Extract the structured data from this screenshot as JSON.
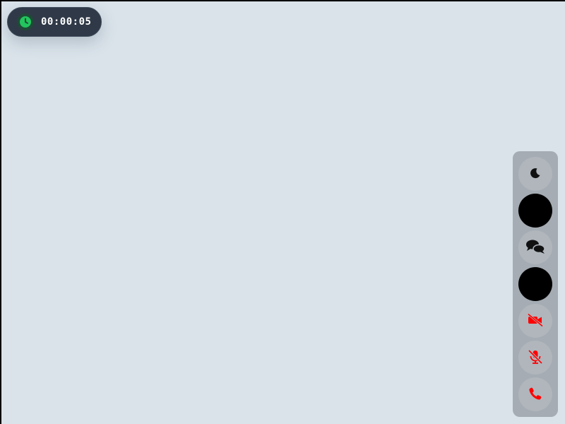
{
  "timer": {
    "elapsed": "00:00:05",
    "icon": "clock-icon",
    "accent": "#22c55e"
  },
  "controls": [
    {
      "name": "dark-mode-toggle",
      "icon": "moon-icon",
      "color": "#111111"
    },
    {
      "name": "participant-slot-1",
      "icon": "",
      "color": "#000000"
    },
    {
      "name": "chat-button",
      "icon": "chat-bubbles-icon",
      "color": "#111111"
    },
    {
      "name": "participant-slot-2",
      "icon": "",
      "color": "#000000"
    },
    {
      "name": "video-toggle",
      "icon": "video-off-icon",
      "color": "#ff0000"
    },
    {
      "name": "mic-toggle",
      "icon": "mic-off-icon",
      "color": "#ff0000"
    },
    {
      "name": "end-call-button",
      "icon": "phone-icon",
      "color": "#ff0000"
    }
  ]
}
